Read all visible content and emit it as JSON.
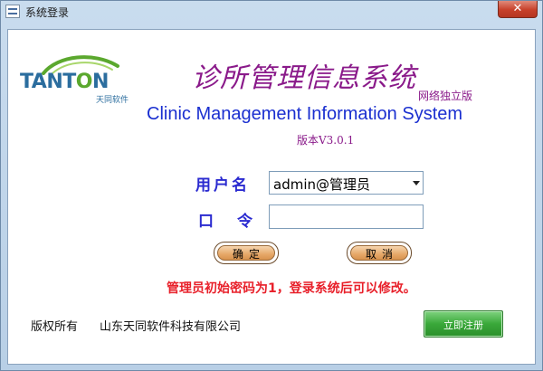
{
  "window": {
    "title": "系统登录",
    "close_label": "✕"
  },
  "logo": {
    "brand_start": "TANT",
    "brand_o": "O",
    "brand_end": "N",
    "sub": "天同软件"
  },
  "header": {
    "cn_title": "诊所管理信息系统",
    "edition": "网络独立版",
    "en_title": "Clinic Management Information System",
    "version": "版本V3.0.1"
  },
  "form": {
    "user_label": "用户名",
    "pass_label_1": "口",
    "pass_label_2": "令",
    "user_value": "admin@管理员",
    "password_value": ""
  },
  "buttons": {
    "ok": "确定",
    "cancel": "取消",
    "register": "立即注册"
  },
  "notice": "管理员初始密码为1，登录系统后可以修改。",
  "footer": {
    "copyright": "版权所有",
    "company": "山东天同软件科技有限公司"
  },
  "colors": {
    "title_purple": "#8a1a8a",
    "english_blue": "#1a2fd0",
    "label_blue": "#2a2ad0",
    "notice_red": "#e8202a",
    "register_green": "#3aa83a"
  },
  "icons": {
    "window_icon": "app-window-icon",
    "logo_arc": "logo-swoosh-icon",
    "dropdown": "chevron-down-icon"
  }
}
